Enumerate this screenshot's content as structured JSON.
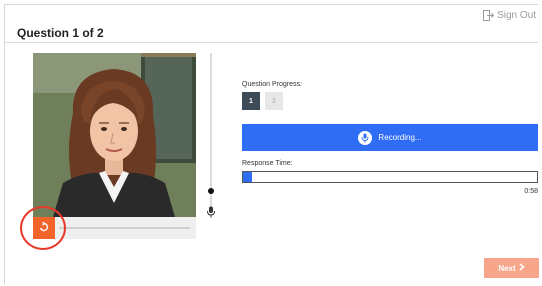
{
  "header": {
    "sign_out_label": "Sign Out",
    "question_title": "Question 1 of 2"
  },
  "progress": {
    "label": "Question Progress:",
    "steps": [
      {
        "label": "1",
        "state": "active"
      },
      {
        "label": "2",
        "state": "inactive"
      }
    ]
  },
  "recording": {
    "label": "Recording...",
    "icon": "microphone-icon"
  },
  "response_time": {
    "label": "Response Time:",
    "remaining": "0:58",
    "elapsed_fraction": 0.03
  },
  "video": {
    "description_icon": "replay-icon"
  },
  "footer": {
    "next_label": "Next"
  },
  "colors": {
    "accent_blue": "#2f6df5",
    "replay_orange": "#f0632a",
    "next_button": "#f7a68b",
    "highlight_ring": "#e83a2a",
    "step_active": "#3d4a57"
  }
}
